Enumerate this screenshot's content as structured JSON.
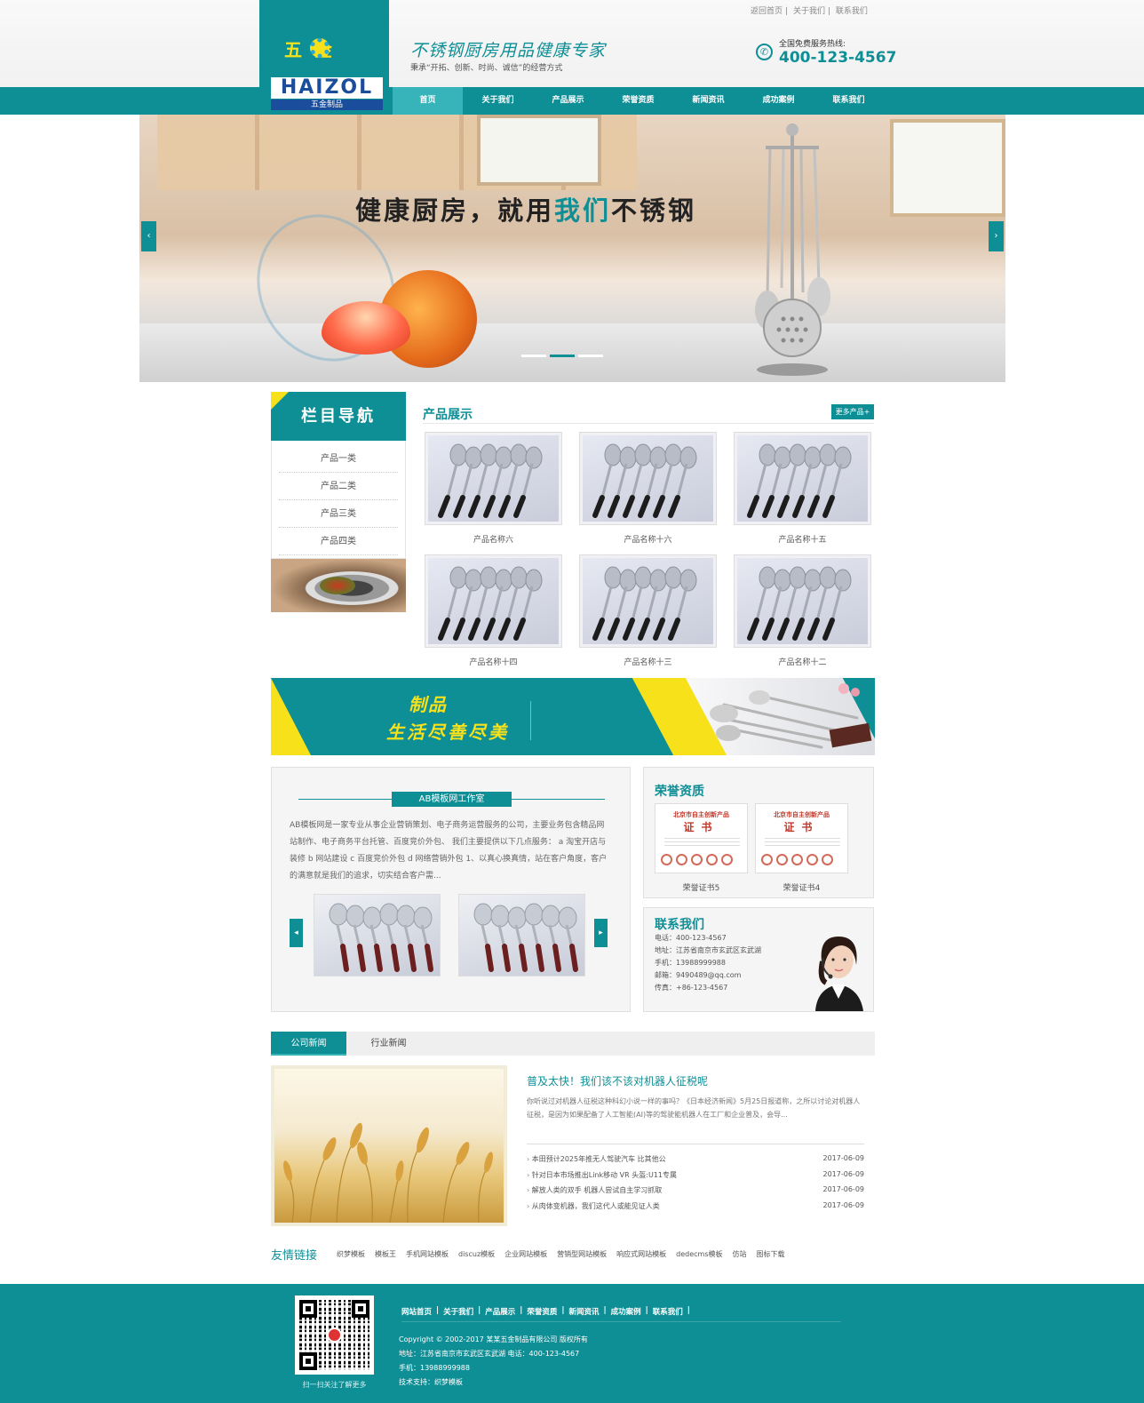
{
  "top_links": [
    "返回首页",
    "关于我们",
    "联系我们"
  ],
  "logo": {
    "cn": "五金",
    "en": "HAIZOL",
    "sub": "五金制品"
  },
  "slogan": {
    "main": "不锈钢厨房用品健康专家",
    "sub": "秉承“开拓、创新、时尚、诚信”的经营方式"
  },
  "hotline": {
    "label": "全国免费服务热线:",
    "number": "400-123-4567"
  },
  "nav": [
    "首页",
    "关于我们",
    "产品展示",
    "荣誉资质",
    "新闻资讯",
    "成功案例",
    "联系我们"
  ],
  "banner": {
    "title_a": "健康厨房，就用",
    "title_b": "我们",
    "title_c": "不锈钢",
    "prev": "‹",
    "next": "›"
  },
  "sidebar": {
    "title": "栏目导航",
    "items": [
      "产品一类",
      "产品二类",
      "产品三类",
      "产品四类"
    ]
  },
  "products": {
    "title": "产品展示",
    "more": "更多产品+",
    "items": [
      "产品名称六",
      "产品名称十六",
      "产品名称十五",
      "产品名称十四",
      "产品名称十三",
      "产品名称十二"
    ]
  },
  "ribbon": {
    "line1": "制品",
    "line2": "生活尽善尽美"
  },
  "about": {
    "title": "AB模板网工作室",
    "text": "AB模板网是一家专业从事企业营销策划、电子商务运营服务的公司，主要业务包含精品网站制作、电子商务平台托管、百度竞价外包、 我们主要提供以下几点服务： a 淘宝开店与装修 b 网站建设 c 百度竞价外包 d 网络营销外包 1、以真心换真情，站在客户角度，客户的满意就是我们的追求，切实结合客户需..."
  },
  "honor": {
    "title": "荣誉资质",
    "certs": [
      {
        "head": "北京市自主创新产品",
        "big": "证书",
        "caption": "荣誉证书5"
      },
      {
        "head": "北京市自主创新产品",
        "big": "证书",
        "caption": "荣誉证书4"
      }
    ]
  },
  "contact": {
    "title": "联系我们",
    "lines": [
      "电话：400-123-4567",
      "地址：江苏省南京市玄武区玄武湖",
      "手机：13988999988",
      "邮箱：9490489@qq.com",
      "传真：+86-123-4567"
    ]
  },
  "news": {
    "tabs": [
      "公司新闻",
      "行业新闻"
    ],
    "headline": "普及太快！我们该不该对机器人征税呢",
    "summary": "你听说过对机器人征税这种科幻小说一样的事吗？《日本经济新闻》5月25日报道称，之所以讨论对机器人征税，是因为如果配备了人工智能(AI)等的驾驶能机器人在工厂和企业普及，会导...",
    "items": [
      {
        "t": "本田预计2025年推无人驾驶汽车 比其他公",
        "d": "2017-06-09"
      },
      {
        "t": "针对日本市场推出Link移动 VR 头盔:U11专属",
        "d": "2017-06-09"
      },
      {
        "t": "解放人类的双手 机器人尝试自主学习抓取",
        "d": "2017-06-09"
      },
      {
        "t": "从肉体变机器，我们这代人或能见证人类",
        "d": "2017-06-09"
      }
    ]
  },
  "friend_links": {
    "title": "友情链接",
    "items": [
      "织梦模板",
      "模板王",
      "手机网站模板",
      "discuz模板",
      "企业网站模板",
      "营销型网站模板",
      "响应式网站模板",
      "dedecms模板",
      "仿站",
      "图标下载"
    ]
  },
  "footer": {
    "qr_caption": "扫一扫关注了解更多",
    "links": [
      "网站首页",
      "关于我们",
      "产品展示",
      "荣誉资质",
      "新闻资讯",
      "成功案例",
      "联系我们"
    ],
    "copyright": "Copyright © 2002-2017 某某五金制品有限公司 版权所有",
    "address": "地址：江苏省南京市玄武区玄武湖 电话：400-123-4567",
    "mobile": "手机：13988999988",
    "support": "技术支持：织梦模板"
  },
  "colors": {
    "primary": "#0e8f96",
    "accent": "#f7e11b",
    "nav_active": "#37b3ba"
  }
}
